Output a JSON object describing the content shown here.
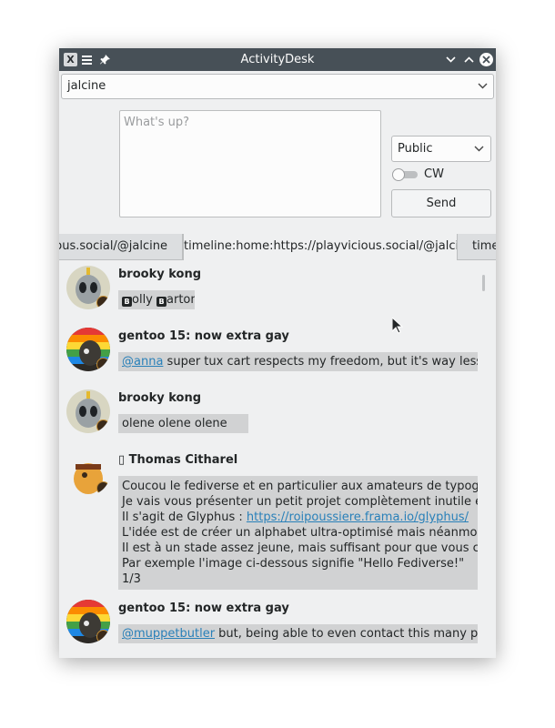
{
  "window": {
    "title": "ActivityDesk"
  },
  "titlebar": {
    "app_icon": "x-app-icon",
    "menu_icon": "hamburger-menu-icon",
    "pin_icon": "pin-icon",
    "minimize_icon": "chevron-down-icon",
    "maximize_icon": "chevron-up-icon",
    "close_icon": "close-icon"
  },
  "account": {
    "selected": "jalcine"
  },
  "compose": {
    "placeholder": "What's up?"
  },
  "visibility": {
    "selected": "Public"
  },
  "cw": {
    "label": "CW",
    "checked": false
  },
  "send": {
    "label": "Send"
  },
  "tabs": [
    {
      "label": "vicious.social/@jalcine"
    },
    {
      "label": "timeline:home:https://playvicious.social/@jalcine",
      "active": true
    },
    {
      "label": "time"
    }
  ],
  "posts": [
    {
      "author": "brooky kong",
      "content": "olly arton",
      "emojis": [
        "B",
        "B"
      ]
    },
    {
      "author": "gentoo 15: now extra gay",
      "mention": "@anna",
      "content": " super tux cart respects my freedom, but it's way less good at si"
    },
    {
      "author": "brooky kong",
      "content": "olene olene olene"
    },
    {
      "author": "▯ Thomas Citharel",
      "lines": [
        "Coucou le fediverse et en particulier aux amateurs de typographie et t",
        "Je vais vous présenter un petit projet complètement inutile et débile, m",
        "Il s'agit de Glyphus : ",
        "L'idée est de créer un alphabet ultra-optimisé mais néanmoins joli, sou",
        "Il est à un stade assez jeune, mais suffisant pour que vous compreniez",
        "Par exemple l'image ci-dessous signifie \"Hello Fediverse!\"",
        "1/3"
      ],
      "link": "https://roipoussiere.frama.io/glyphus/"
    },
    {
      "author": "gentoo 15: now extra gay",
      "mention": "@muppetbutler",
      "content": " but, being able to even contact this many people on a r"
    }
  ],
  "colors": {
    "titlebar": "#475057",
    "window_bg": "#eff0f1",
    "link": "#2980b9",
    "post_bg": "#d1d2d3"
  }
}
